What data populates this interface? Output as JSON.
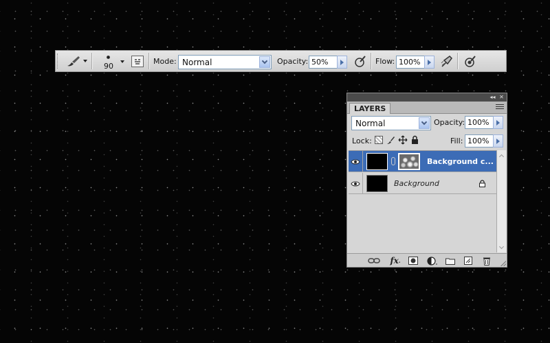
{
  "options_bar": {
    "brush_size": "90",
    "mode_label": "Mode:",
    "mode_value": "Normal",
    "opacity_label": "Opacity:",
    "opacity_value": "50%",
    "flow_label": "Flow:",
    "flow_value": "100%",
    "icons": [
      "brush-tool-icon",
      "brush-preset-icon",
      "brush-panel-toggle-icon",
      "pressure-opacity-icon",
      "airbrush-icon",
      "pressure-size-icon"
    ]
  },
  "layers_panel": {
    "tab_label": "LAYERS",
    "blend_mode": "Normal",
    "opacity_label": "Opacity:",
    "opacity_value": "100%",
    "lock_label": "Lock:",
    "fill_label": "Fill:",
    "fill_value": "100%",
    "layers": [
      {
        "name": "Background c...",
        "selected": true,
        "visible": true
      },
      {
        "name": "Background",
        "selected": false,
        "visible": true,
        "locked": true
      }
    ],
    "footer_icons": [
      "link-layers-icon",
      "fx-icon",
      "add-mask-icon",
      "adjustment-layer-icon",
      "new-group-icon",
      "new-layer-icon",
      "delete-layer-icon"
    ],
    "fx_label": "fx"
  },
  "colors": {
    "selection": "#3c6cb6",
    "panel_bg": "#d6d6d6",
    "canvas_bg": "#050505"
  }
}
